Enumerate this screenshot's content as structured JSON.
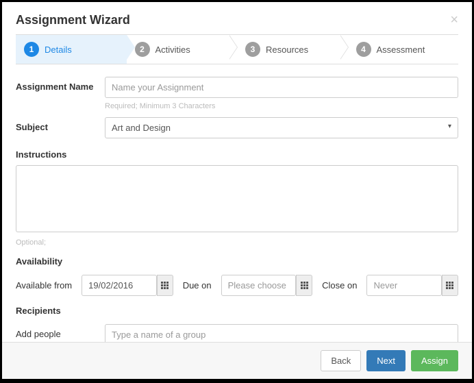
{
  "header": {
    "title": "Assignment Wizard"
  },
  "tabs": [
    {
      "num": "1",
      "label": "Details"
    },
    {
      "num": "2",
      "label": "Activities"
    },
    {
      "num": "3",
      "label": "Resources"
    },
    {
      "num": "4",
      "label": "Assessment"
    }
  ],
  "form": {
    "name_label": "Assignment Name",
    "name_placeholder": "Name your Assignment",
    "name_hint": "Required; Minimum 3 Characters",
    "subject_label": "Subject",
    "subject_value": "Art and Design",
    "instructions_label": "Instructions",
    "instructions_hint": "Optional;",
    "availability_label": "Availability",
    "available_from_label": "Available from",
    "available_from_value": "19/02/2016",
    "due_label": "Due on",
    "due_placeholder": "Please choose",
    "close_label": "Close on",
    "close_placeholder": "Never",
    "recipients_label": "Recipients",
    "add_people_label": "Add people",
    "add_people_placeholder": "Type a name of a group"
  },
  "footer": {
    "back": "Back",
    "next": "Next",
    "assign": "Assign"
  }
}
